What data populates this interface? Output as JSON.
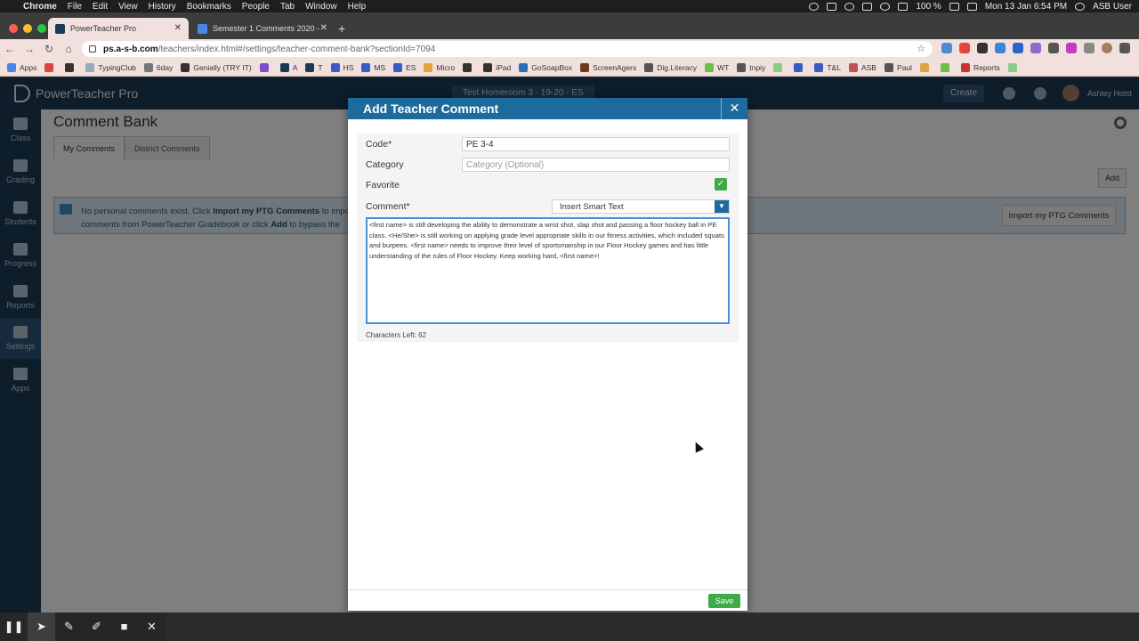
{
  "menubar": {
    "app": "Chrome",
    "items": [
      "File",
      "Edit",
      "View",
      "History",
      "Bookmarks",
      "People",
      "Tab",
      "Window",
      "Help"
    ],
    "battery": "100 %",
    "datetime": "Mon 13 Jan  6:54 PM",
    "user": "ASB User"
  },
  "browser": {
    "tabs": [
      {
        "title": "PowerTeacher Pro",
        "active": true
      },
      {
        "title": "Semester 1 Comments 2020 -",
        "active": false
      }
    ],
    "url_host": "ps.a-s-b.com",
    "url_path": "/teachers/index.html#/settings/teacher-comment-bank?sectionId=7094",
    "bookmarks": [
      "Apps",
      "",
      "",
      "TypingClub",
      "6day",
      "Genially (TRY IT)",
      "",
      "A",
      "T",
      "HS",
      "MS",
      "ES",
      "Micro",
      "",
      "iPad",
      "GoSoapBox",
      "ScreenAgers",
      "Dig.Literacy",
      "WT",
      "tnpiy",
      "",
      "",
      "T&L",
      "ASB",
      "Paul",
      "",
      "",
      "Reports",
      ""
    ]
  },
  "app": {
    "name": "PowerTeacher Pro",
    "section": "Test Homeroom 3  ·  19-20 - ES",
    "create_label": "Create",
    "user_name": "Ashley Holst",
    "nav": [
      {
        "label": "Class",
        "active": false
      },
      {
        "label": "Grading",
        "active": false
      },
      {
        "label": "Students",
        "active": false
      },
      {
        "label": "Progress",
        "active": false
      },
      {
        "label": "Reports",
        "active": false
      },
      {
        "label": "Settings",
        "active": true
      },
      {
        "label": "Apps",
        "active": false
      }
    ]
  },
  "page": {
    "title": "Comment Bank",
    "tabs": [
      "My Comments",
      "District Comments"
    ],
    "add_label": "Add",
    "info_prefix": "No personal comments exist. Click ",
    "info_bold1": "Import my PTG Comments",
    "info_mid": " to import comments from PowerTeacher Gradebook or click ",
    "info_bold2": "Add",
    "info_suffix": " to bypass the import feature and",
    "import_label": "Import my PTG Comments"
  },
  "dialog": {
    "title": "Add Teacher Comment",
    "code_label": "Code*",
    "code_value": "PE 3-4",
    "category_label": "Category",
    "category_placeholder": "Category (Optional)",
    "favorite_label": "Favorite",
    "favorite_checked": true,
    "comment_label": "Comment*",
    "smart_text_label": "Insert Smart Text",
    "comment_value": "<first name> is still developing the ability to demonstrate a wrist shot, slap shot and passing a floor hockey ball in PE class. <He/She> is still working on applying grade level appropriate skills in our fitness activities, which included squats and burpees. <first name> needs to improve their level of sportsmanship in our Floor Hockey games and has little understanding of the rules of Floor Hockey. Keep working hard, <first name>!",
    "chars_left": "Characters Left: 62",
    "save_label": "Save"
  },
  "colors": {
    "header": "#1b3b55",
    "dialog_header": "#1d6a9c",
    "save": "#3eaa4a",
    "checkbox": "#3eaa4a"
  }
}
